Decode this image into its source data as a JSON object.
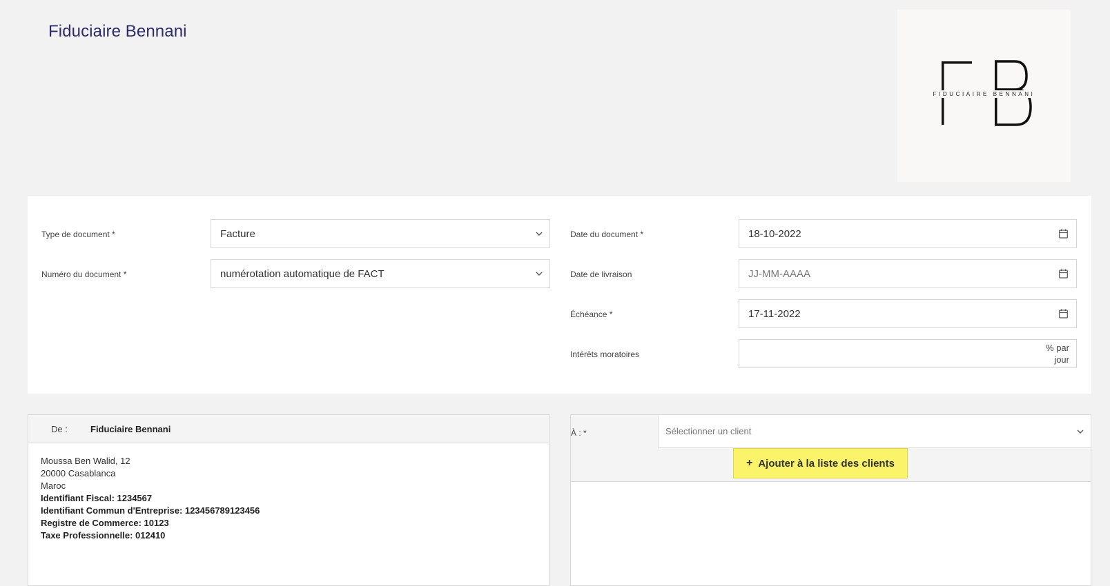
{
  "header": {
    "company_title": "Fiduciaire Bennani",
    "logo_tagline": "FIDUCIAIRE BENNANI",
    "logo_letters": "FB"
  },
  "document_form": {
    "type": {
      "label": "Type de document *",
      "value": "Facture"
    },
    "number": {
      "label": "Numéro du document *",
      "value": "numérotation automatique de FACT"
    },
    "date": {
      "label": "Date du document *",
      "value": "18-10-2022"
    },
    "delivery_date": {
      "label": "Date de livraison",
      "placeholder": "JJ-MM-AAAA"
    },
    "due_date": {
      "label": "Échéance *",
      "value": "17-11-2022"
    },
    "interest": {
      "label": "Intérêts moratoires",
      "value": "",
      "suffix": "% par jour"
    }
  },
  "sender": {
    "label": "De :",
    "name": "Fiduciaire Bennani",
    "address_line1": "Moussa Ben Walid, 12",
    "address_line2": "20000 Casablanca",
    "country": "Maroc",
    "fiscal_id": "Identifiant Fiscal: 1234567",
    "ice": "Identifiant Commun d'Entreprise: 123456789123456",
    "rc": "Registre de Commerce: 10123",
    "tp": "Taxe Professionnelle: 012410"
  },
  "recipient": {
    "label": "À : *",
    "select_placeholder": "Sélectionner un client",
    "add_button_label": "Ajouter à la liste des clients",
    "add_button_icon": "plus-icon"
  },
  "colors": {
    "background": "#f2f2f2",
    "title": "#2d2a6e",
    "highlight_button": "#fbf46a"
  }
}
